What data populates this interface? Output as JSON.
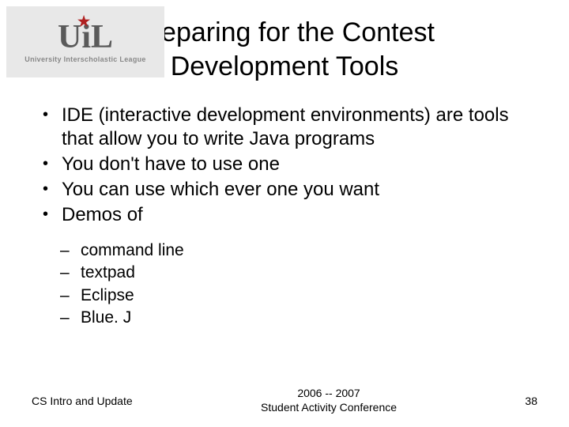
{
  "logo": {
    "text": "UiL",
    "subtitle": "University Interscholastic League"
  },
  "title": {
    "line1": "Preparing for the Contest",
    "line2": "Development Tools"
  },
  "bullets": [
    "IDE (interactive development environments) are tools that allow you to write Java programs",
    "You don't have to use one",
    "You can use which ever one you want",
    "Demos of"
  ],
  "sub_bullets": [
    "command line",
    "textpad",
    "Eclipse",
    "Blue. J"
  ],
  "footer": {
    "left": "CS Intro and Update",
    "center_line1": "2006 -- 2007",
    "center_line2": "Student Activity Conference",
    "right": "38"
  }
}
